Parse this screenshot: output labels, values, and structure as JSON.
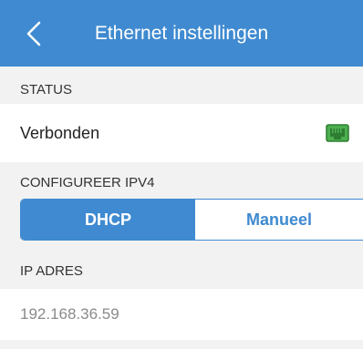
{
  "header": {
    "title": "Ethernet instellingen",
    "back_icon": "chevron-left-icon",
    "color": "#3f8ad0"
  },
  "status_section": {
    "header": "STATUS",
    "value": "Verbonden",
    "icon": "ethernet-connected-icon",
    "icon_color": "#4caf50"
  },
  "ipv4_section": {
    "header": "CONFIGUREER IPV4",
    "options": [
      "DHCP",
      "Manueel"
    ],
    "selected": "DHCP"
  },
  "ip_section": {
    "header": "IP ADRES",
    "value": "192.168.36.59"
  }
}
